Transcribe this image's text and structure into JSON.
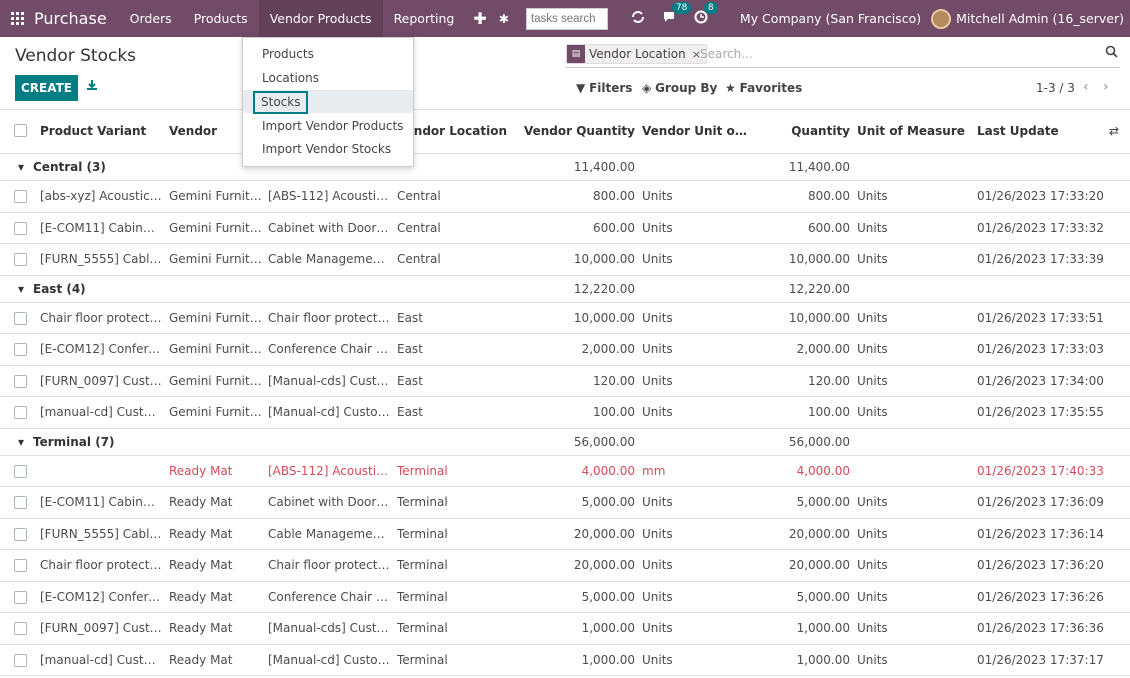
{
  "nav": {
    "app_name": "Purchase",
    "menus": [
      "Orders",
      "Products",
      "Vendor Products",
      "Reporting"
    ],
    "plus": "✚",
    "bug": "✱",
    "tasks_search_placeholder": "tasks search",
    "messages_count": "78",
    "activity_count": "8",
    "company": "My Company (San Francisco)",
    "user": "Mitchell Admin (16_server)"
  },
  "dropdown": {
    "items": [
      "Products",
      "Locations",
      "Stocks",
      "Import Vendor Products",
      "Import Vendor Stocks"
    ],
    "selected": "Stocks"
  },
  "control": {
    "title": "Vendor Stocks",
    "create_label": "CREATE",
    "facet_label": "Vendor Location",
    "facet_remove": "×",
    "search_placeholder": "Search...",
    "filters_label": "Filters",
    "groupby_label": "Group By",
    "favorites_label": "Favorites",
    "pager": "1-3 / 3",
    "pager_prev": "‹",
    "pager_next": "›"
  },
  "table": {
    "headers": {
      "product": "Product Variant",
      "vendor": "Vendor",
      "location": "Vendor Location",
      "vqty": "Vendor Quantity",
      "vuom": "Vendor Unit of ...",
      "qty": "Quantity",
      "uom": "Unit of Measure",
      "update": "Last Update"
    },
    "rows": [
      {
        "type": "group",
        "label": "Central (3)",
        "vqty": "11,400.00",
        "qty": "11,400.00"
      },
      {
        "type": "record",
        "product": "[abs-xyz] Acoustic Bl...",
        "vendor": "Gemini Furniture",
        "vprod": "[ABS-112] Acoustic ...",
        "location": "Central",
        "vqty": "800.00",
        "vuom": "Units",
        "qty": "800.00",
        "uom": "Units",
        "update": "01/26/2023 17:33:20"
      },
      {
        "type": "record",
        "product": "[E-COM11] Cabinet ...",
        "vendor": "Gemini Furniture",
        "vprod": "Cabinet with Doors ...",
        "location": "Central",
        "vqty": "600.00",
        "vuom": "Units",
        "qty": "600.00",
        "uom": "Units",
        "update": "01/26/2023 17:33:32"
      },
      {
        "type": "record",
        "product": "[FURN_5555] Cable ...",
        "vendor": "Gemini Furniture",
        "vprod": "Cable Management ...",
        "location": "Central",
        "vqty": "10,000.00",
        "vuom": "Units",
        "qty": "10,000.00",
        "uom": "Units",
        "update": "01/26/2023 17:33:39"
      },
      {
        "type": "group",
        "label": "East (4)",
        "vqty": "12,220.00",
        "qty": "12,220.00"
      },
      {
        "type": "record",
        "product": "Chair floor protection",
        "vendor": "Gemini Furniture",
        "vprod": "Chair floor protecti...",
        "location": "East",
        "vqty": "10,000.00",
        "vuom": "Units",
        "qty": "10,000.00",
        "uom": "Units",
        "update": "01/26/2023 17:33:51"
      },
      {
        "type": "record",
        "product": "[E-COM12] Confere...",
        "vendor": "Gemini Furniture",
        "vprod": "Conference Chair - ...",
        "location": "East",
        "vqty": "2,000.00",
        "vuom": "Units",
        "qty": "2,000.00",
        "uom": "Units",
        "update": "01/26/2023 17:33:03"
      },
      {
        "type": "record",
        "product": "[FURN_0097] Custo...",
        "vendor": "Gemini Furniture",
        "vprod": "[Manual-cds] Custo...",
        "location": "East",
        "vqty": "120.00",
        "vuom": "Units",
        "qty": "120.00",
        "uom": "Units",
        "update": "01/26/2023 17:34:00"
      },
      {
        "type": "record",
        "product": "[manual-cd] Custom...",
        "vendor": "Gemini Furniture",
        "vprod": "[Manual-cd] Custom...",
        "location": "East",
        "vqty": "100.00",
        "vuom": "Units",
        "qty": "100.00",
        "uom": "Units",
        "update": "01/26/2023 17:35:55"
      },
      {
        "type": "group",
        "label": "Terminal (7)",
        "vqty": "56,000.00",
        "qty": "56,000.00"
      },
      {
        "type": "record",
        "warn": true,
        "product": "",
        "vendor": "Ready Mat",
        "vprod": "[ABS-112] Acoustic ...",
        "location": "Terminal",
        "vqty": "4,000.00",
        "vuom": "mm",
        "qty": "4,000.00",
        "uom": "",
        "update": "01/26/2023 17:40:33"
      },
      {
        "type": "record",
        "product": "[E-COM11] Cabinet ...",
        "vendor": "Ready Mat",
        "vprod": "Cabinet with Doors ...",
        "location": "Terminal",
        "vqty": "5,000.00",
        "vuom": "Units",
        "qty": "5,000.00",
        "uom": "Units",
        "update": "01/26/2023 17:36:09"
      },
      {
        "type": "record",
        "product": "[FURN_5555] Cable ...",
        "vendor": "Ready Mat",
        "vprod": "Cable Management ...",
        "location": "Terminal",
        "vqty": "20,000.00",
        "vuom": "Units",
        "qty": "20,000.00",
        "uom": "Units",
        "update": "01/26/2023 17:36:14"
      },
      {
        "type": "record",
        "product": "Chair floor protection",
        "vendor": "Ready Mat",
        "vprod": "Chair floor protecti...",
        "location": "Terminal",
        "vqty": "20,000.00",
        "vuom": "Units",
        "qty": "20,000.00",
        "uom": "Units",
        "update": "01/26/2023 17:36:20"
      },
      {
        "type": "record",
        "product": "[E-COM12] Confere...",
        "vendor": "Ready Mat",
        "vprod": "Conference Chair - ...",
        "location": "Terminal",
        "vqty": "5,000.00",
        "vuom": "Units",
        "qty": "5,000.00",
        "uom": "Units",
        "update": "01/26/2023 17:36:26"
      },
      {
        "type": "record",
        "product": "[FURN_0097] Custo...",
        "vendor": "Ready Mat",
        "vprod": "[Manual-cds] Custo...",
        "location": "Terminal",
        "vqty": "1,000.00",
        "vuom": "Units",
        "qty": "1,000.00",
        "uom": "Units",
        "update": "01/26/2023 17:36:36"
      },
      {
        "type": "record",
        "product": "[manual-cd] Custom...",
        "vendor": "Ready Mat",
        "vprod": "[Manual-cd] Custom...",
        "location": "Terminal",
        "vqty": "1,000.00",
        "vuom": "Units",
        "qty": "1,000.00",
        "uom": "Units",
        "update": "01/26/2023 17:37:17"
      }
    ]
  },
  "colors": {
    "brand": "#714b67",
    "primary": "#017e84",
    "warning_text": "#d44c59"
  }
}
